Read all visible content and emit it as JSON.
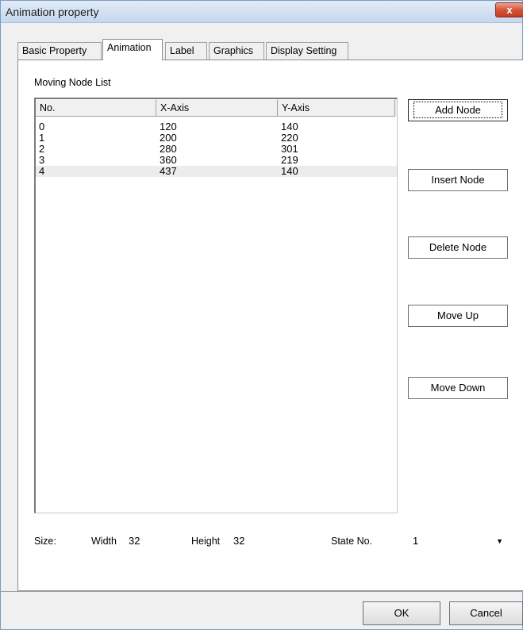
{
  "window": {
    "title": "Animation property",
    "close_symbol": "x"
  },
  "tabs": [
    {
      "label": "Basic Property",
      "active": false
    },
    {
      "label": "Animation",
      "active": true
    },
    {
      "label": "Label",
      "active": false
    },
    {
      "label": "Graphics",
      "active": false
    },
    {
      "label": "Display Setting",
      "active": false
    }
  ],
  "node_list": {
    "label": "Moving Node List",
    "columns": [
      "No.",
      "X-Axis",
      "Y-Axis"
    ],
    "rows": [
      {
        "no": "0",
        "x": "120",
        "y": "140"
      },
      {
        "no": "1",
        "x": "200",
        "y": "220"
      },
      {
        "no": "2",
        "x": "280",
        "y": "301"
      },
      {
        "no": "3",
        "x": "360",
        "y": "219"
      },
      {
        "no": "4",
        "x": "437",
        "y": "140"
      }
    ],
    "selected_index": 4
  },
  "buttons": {
    "add_node": "Add Node",
    "insert_node": "Insert Node",
    "delete_node": "Delete Node",
    "move_up": "Move Up",
    "move_down": "Move Down"
  },
  "size": {
    "label": "Size:",
    "width_label": "Width",
    "width_value": "32",
    "height_label": "Height",
    "height_value": "32"
  },
  "state": {
    "label": "State No.",
    "value": "1"
  },
  "dialog": {
    "ok": "OK",
    "cancel": "Cancel"
  }
}
